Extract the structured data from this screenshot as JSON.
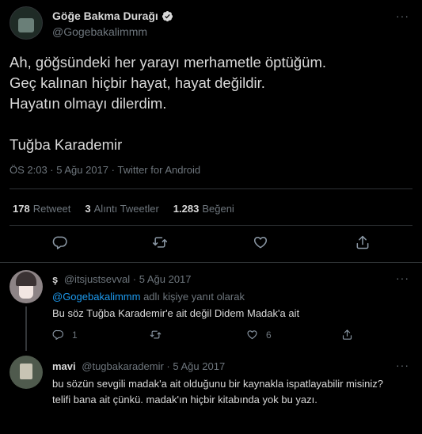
{
  "tweet": {
    "author_name": "Göğe Bakma Durağı",
    "author_handle": "@Gogebakalimmm",
    "text_lines": [
      "Ah, göğsündeki her yarayı merhametle öptüğüm.",
      "Geç kalınan hiçbir hayat, hayat değildir.",
      "Hayatın olmayı dilerdim.",
      "",
      "Tuğba Karademir"
    ],
    "meta": "ÖS 2:03 · 5 Ağu 2017 · Twitter for Android",
    "stats": {
      "retweets_count": "178",
      "retweets_label": "Retweet",
      "quotes_count": "3",
      "quotes_label": "Alıntı Tweetler",
      "likes_count": "1.283",
      "likes_label": "Beğeni"
    }
  },
  "replies": [
    {
      "name": "ş",
      "handle": "@itsjustsevval",
      "date": "5 Ağu 2017",
      "reply_to_handle": "@Gogebakalimmm",
      "reply_to_suffix": "adlı kişiye yanıt olarak",
      "text_lines": [
        "Bu söz Tuğba Karademir'e ait değil Didem Madak'a ait"
      ],
      "reply_count": "1",
      "like_count": "6"
    },
    {
      "name": "mavi",
      "handle": "@tugbakarademir",
      "date": "5 Ağu 2017",
      "text_lines": [
        "bu sözün sevgili madak'a ait olduğunu bir kaynakla ispatlayabilir misiniz?",
        "telifi bana ait çünkü. madak'ın hiçbir kitabında yok bu yazı."
      ]
    }
  ],
  "ui": {
    "more_glyph": "···",
    "separator": "·",
    "icons": [
      "verified-badge-icon",
      "reply-icon",
      "retweet-icon",
      "like-icon",
      "share-icon",
      "more-icon"
    ],
    "accent": "#1d9bf0",
    "background": "#000000",
    "divider": "#2f3336",
    "muted_text": "#6e767d"
  }
}
